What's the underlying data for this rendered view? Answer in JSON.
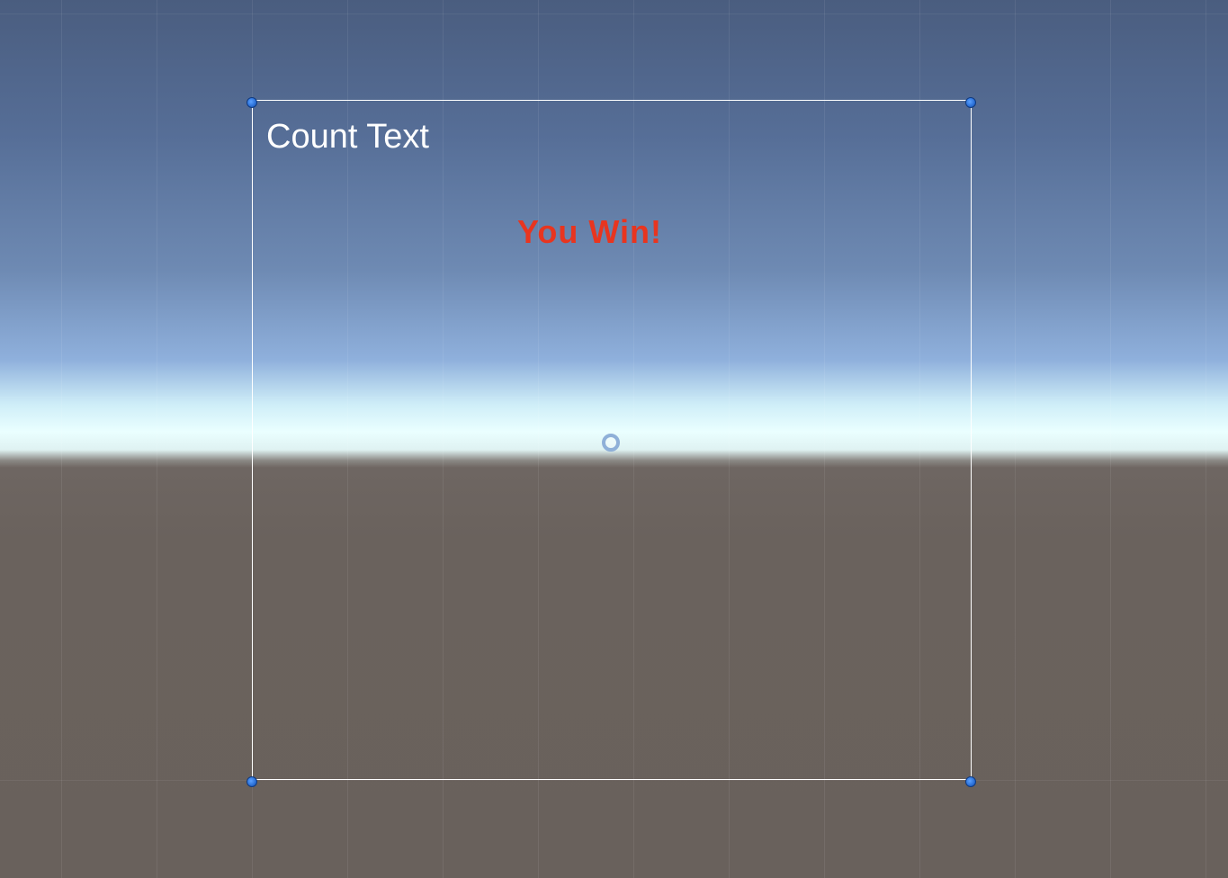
{
  "scene": {
    "count_text": "Count Text",
    "win_text": "You Win!",
    "colors": {
      "win_text": "#e8351f",
      "count_text": "#ffffff",
      "handle": "#2a6fd6",
      "sky_top": "#4a5d7f",
      "horizon": "#eaffff",
      "ground": "#69615c"
    },
    "icons": {
      "handles": "rect-transform-corner-handle",
      "pivot": "pivot-icon"
    }
  }
}
